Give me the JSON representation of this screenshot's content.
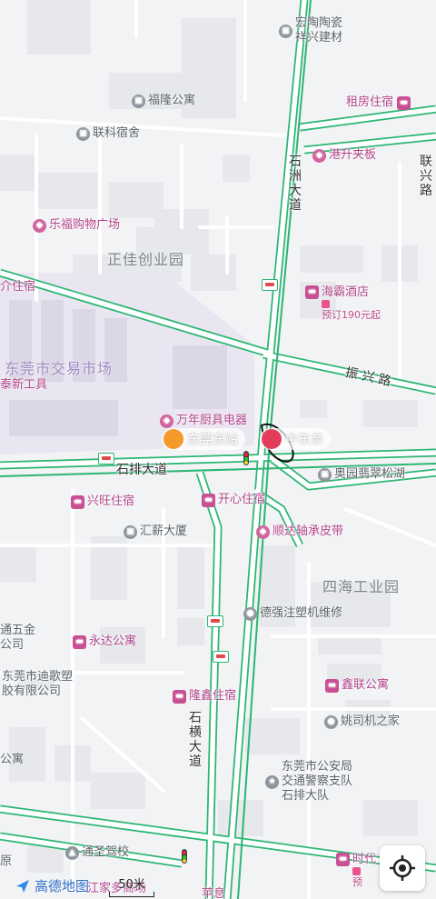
{
  "colors": {
    "background": "#f2f3f5",
    "block": "#e6e8ec",
    "road_edge": "#2bb673",
    "road_fill": "#ffffff",
    "market_area": "#e9e6f1",
    "poi_pink": "#b1458a",
    "poi_gray": "#5b6168"
  },
  "roads": {
    "shizhou": [
      "石",
      "洲",
      "大",
      "道"
    ],
    "zhenxing": "振 兴 路",
    "shipai": "石排大道",
    "shiheng": [
      "石",
      "横",
      "大",
      "道"
    ],
    "lianxing": [
      "联",
      "兴",
      "路"
    ]
  },
  "areas": {
    "zhengjia": "正佳创业园",
    "sihai": "四海工业园",
    "market": "东莞市交易市场"
  },
  "pois": {
    "hongtao": "宏陶陶瓷",
    "xiangxing": "祥兴建材",
    "fulong": "福隆公寓",
    "lianke": "联科宿舍",
    "zufang": "租房住宿",
    "gangsheng": "港升夹板",
    "lefu": "乐福购物广场",
    "jiexin": "介住宿",
    "haiba": "海霸酒店",
    "haiba_price": "预订190元起",
    "taixin": "泰新工具",
    "wanqian": "万年厨具电器",
    "aoyuan": "奥园翡翠松湖",
    "xingwang": "兴旺住宿",
    "kaixin": "开心住宿",
    "huixin": "汇薪大厦",
    "shunda": "顺达轴承皮带",
    "deqiang": "德强注塑机维修",
    "tongwu": [
      "通五金",
      "公司"
    ],
    "yongda": "永达公寓",
    "digesu": [
      "东莞市迪歌塑",
      "胶有限公司"
    ],
    "longxin": "隆鑫住宿",
    "xinlian": "鑫联公寓",
    "yaosiji": "姚司机之家",
    "gongan": [
      "东莞市公安局",
      "交通警察支队",
      "石排大队"
    ],
    "gongyu": "公寓",
    "tongsheng": "通圣驾校",
    "shidai": "时代",
    "shidai_sub": "预",
    "yuan": "原",
    "bottom_cut": "江家多商场",
    "bottom_cut2": "苹息"
  },
  "badges": {
    "left": "东莞东站",
    "right": "中东亲"
  },
  "logo": "高德地图",
  "scale": "50米",
  "icons": {
    "locate": "locate-icon",
    "logo": "navigation-arrow-icon",
    "hotel": "bed-icon",
    "shop": "bag-icon",
    "building": "building-icon"
  }
}
